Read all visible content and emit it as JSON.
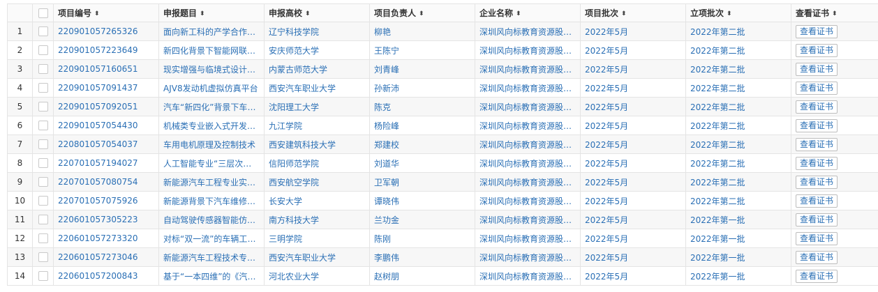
{
  "table": {
    "columns": [
      "项目编号",
      "申报题目",
      "申报高校",
      "项目负责人",
      "企业名称",
      "项目批次",
      "立项批次",
      "查看证书"
    ],
    "sort_icon": "sort-icon",
    "rows": [
      {
        "index": "1",
        "code": "220901057265326",
        "title": "面向新工科的产学合作…",
        "school": "辽宁科技学院",
        "leader": "柳艳",
        "company": "深圳风向标教育资源股…",
        "batch": "2022年5月",
        "approval": "2022年第二批",
        "cert": "查看证书"
      },
      {
        "index": "2",
        "code": "220901057223649",
        "title": "新四化背景下智能网联…",
        "school": "安庆师范大学",
        "leader": "王陈宁",
        "company": "深圳风向标教育资源股…",
        "batch": "2022年5月",
        "approval": "2022年第二批",
        "cert": "查看证书"
      },
      {
        "index": "3",
        "code": "220901057160651",
        "title": "现实增强与临境式设计…",
        "school": "内蒙古师范大学",
        "leader": "刘青峰",
        "company": "深圳风向标教育资源股…",
        "batch": "2022年5月",
        "approval": "2022年第二批",
        "cert": "查看证书"
      },
      {
        "index": "4",
        "code": "220901057091437",
        "title": "AJV8发动机虚拟仿真平台",
        "school": "西安汽车职业大学",
        "leader": "孙新沛",
        "company": "深圳风向标教育资源股…",
        "batch": "2022年5月",
        "approval": "2022年第二批",
        "cert": "查看证书"
      },
      {
        "index": "5",
        "code": "220901057092051",
        "title": "汽车“新四化”背景下车辆…",
        "school": "沈阳理工大学",
        "leader": "陈克",
        "company": "深圳风向标教育资源股…",
        "batch": "2022年5月",
        "approval": "2022年第二批",
        "cert": "查看证书"
      },
      {
        "index": "6",
        "code": "220901057054430",
        "title": "机械类专业嵌入式开发…",
        "school": "九江学院",
        "leader": "杨险峰",
        "company": "深圳风向标教育资源股…",
        "batch": "2022年5月",
        "approval": "2022年第二批",
        "cert": "查看证书"
      },
      {
        "index": "7",
        "code": "220801057054037",
        "title": "车用电机原理及控制技术",
        "school": "西安建筑科技大学",
        "leader": "郑建校",
        "company": "深圳风向标教育资源股…",
        "batch": "2022年5月",
        "approval": "2022年第二批",
        "cert": "查看证书"
      },
      {
        "index": "8",
        "code": "220701057194027",
        "title": "人工智能专业“三层次四…",
        "school": "信阳师范学院",
        "leader": "刘道华",
        "company": "深圳风向标教育资源股…",
        "batch": "2022年5月",
        "approval": "2022年第二批",
        "cert": "查看证书"
      },
      {
        "index": "9",
        "code": "220701057080754",
        "title": "新能源汽车工程专业实…",
        "school": "西安航空学院",
        "leader": "卫军朝",
        "company": "深圳风向标教育资源股…",
        "batch": "2022年5月",
        "approval": "2022年第二批",
        "cert": "查看证书"
      },
      {
        "index": "10",
        "code": "220701057075926",
        "title": "新能源背景下汽车维修…",
        "school": "长安大学",
        "leader": "谭晓伟",
        "company": "深圳风向标教育资源股…",
        "batch": "2022年5月",
        "approval": "2022年第二批",
        "cert": "查看证书"
      },
      {
        "index": "11",
        "code": "220601057305223",
        "title": "自动驾驶传感器智能仿…",
        "school": "南方科技大学",
        "leader": "兰功金",
        "company": "深圳风向标教育资源股…",
        "batch": "2022年5月",
        "approval": "2022年第一批",
        "cert": "查看证书"
      },
      {
        "index": "12",
        "code": "220601057273320",
        "title": "对标“双一流”的车辆工程…",
        "school": "三明学院",
        "leader": "陈刚",
        "company": "深圳风向标教育资源股…",
        "batch": "2022年5月",
        "approval": "2022年第一批",
        "cert": "查看证书"
      },
      {
        "index": "13",
        "code": "220601057273046",
        "title": "新能源汽车工程技术专…",
        "school": "西安汽车职业大学",
        "leader": "李鹏伟",
        "company": "深圳风向标教育资源股…",
        "batch": "2022年5月",
        "approval": "2022年第一批",
        "cert": "查看证书"
      },
      {
        "index": "14",
        "code": "220601057200843",
        "title": "基于“一本四维”的《汽车…",
        "school": "河北农业大学",
        "leader": "赵树朋",
        "company": "深圳风向标教育资源股…",
        "batch": "2022年5月",
        "approval": "2022年第一批",
        "cert": "查看证书"
      }
    ]
  }
}
